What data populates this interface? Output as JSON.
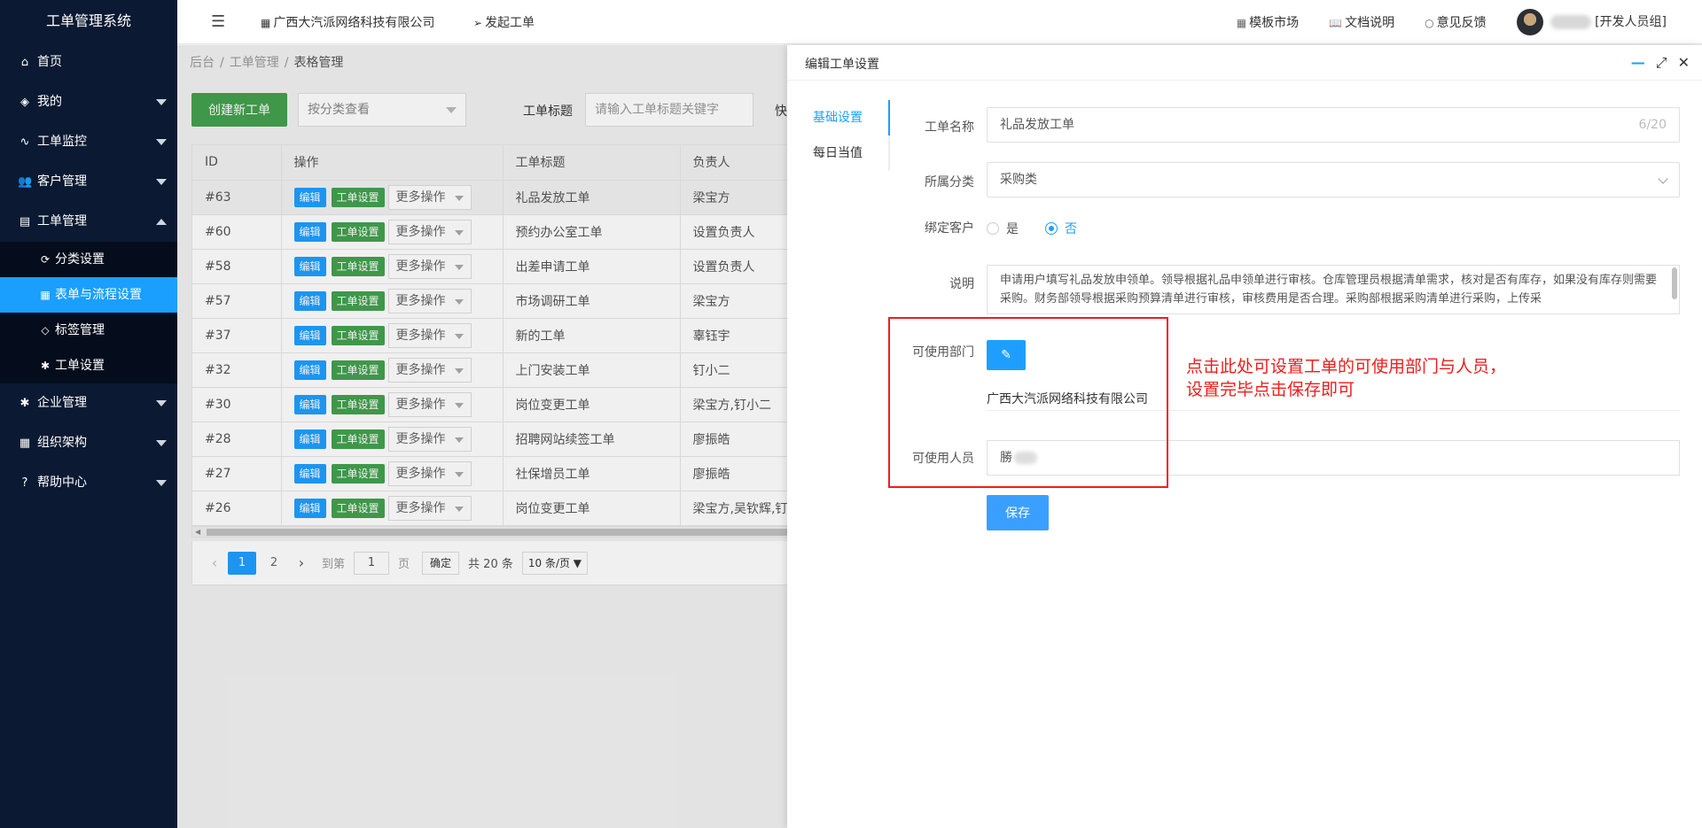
{
  "app": {
    "title": "工单管理系统"
  },
  "sidebar": {
    "items": [
      {
        "label": "首页",
        "icon": "home-icon",
        "glyph": "⌂"
      },
      {
        "label": "我的",
        "icon": "layers-icon",
        "glyph": "◈"
      },
      {
        "label": "工单监控",
        "icon": "pulse-icon",
        "glyph": "∿"
      },
      {
        "label": "客户管理",
        "icon": "users-icon",
        "glyph": "👥"
      },
      {
        "label": "工单管理",
        "icon": "document-icon",
        "glyph": "▤"
      }
    ],
    "sub_items": [
      {
        "label": "分类设置",
        "icon": "refresh-icon",
        "glyph": "⟳"
      },
      {
        "label": "表单与流程设置",
        "icon": "grid-icon",
        "glyph": "▦"
      },
      {
        "label": "标签管理",
        "icon": "tag-icon",
        "glyph": "◇"
      },
      {
        "label": "工单设置",
        "icon": "gear-icon",
        "glyph": "✱"
      }
    ],
    "more_items": [
      {
        "label": "企业管理",
        "icon": "gear-icon",
        "glyph": "✱"
      },
      {
        "label": "组织架构",
        "icon": "calendar-icon",
        "glyph": "▦"
      },
      {
        "label": "帮助中心",
        "icon": "question-icon",
        "glyph": "?"
      }
    ]
  },
  "topbar": {
    "company": "广西大汽派网络科技有限公司",
    "start_ticket": "发起工单",
    "links": {
      "templates": "模板市场",
      "docs": "文档说明",
      "feedback": "意见反馈"
    },
    "user_role": "[开发人员组]"
  },
  "breadcrumb": {
    "home": "后台",
    "level1": "工单管理",
    "current": "表格管理"
  },
  "toolbar": {
    "create_label": "创建新工单",
    "category_placeholder": "按分类查看",
    "title_label": "工单标题",
    "title_placeholder": "请输入工单标题关键字",
    "quick_label": "快"
  },
  "table": {
    "headers": {
      "id": "ID",
      "ops": "操作",
      "title": "工单标题",
      "owner": "负责人"
    },
    "btn_edit": "编辑",
    "btn_set": "工单设置",
    "btn_more": "更多操作",
    "rows": [
      {
        "id": "#63",
        "title": "礼品发放工单",
        "owner": "梁宝方"
      },
      {
        "id": "#60",
        "title": "预约办公室工单",
        "owner": "设置负责人"
      },
      {
        "id": "#58",
        "title": "出差申请工单",
        "owner": "设置负责人"
      },
      {
        "id": "#57",
        "title": "市场调研工单",
        "owner": "梁宝方"
      },
      {
        "id": "#37",
        "title": "新的工单",
        "owner": "辜钰宇"
      },
      {
        "id": "#32",
        "title": "上门安装工单",
        "owner": "钉小二"
      },
      {
        "id": "#30",
        "title": "岗位变更工单",
        "owner": "梁宝方,钉小二"
      },
      {
        "id": "#28",
        "title": "招聘网站续签工单",
        "owner": "廖振皓"
      },
      {
        "id": "#27",
        "title": "社保增员工单",
        "owner": "廖振皓"
      },
      {
        "id": "#26",
        "title": "岗位变更工单",
        "owner": "梁宝方,吴钦辉,钉"
      }
    ]
  },
  "pager": {
    "page1": "1",
    "page2": "2",
    "goto_label": "到第",
    "goto_value": "1",
    "page_unit": "页",
    "confirm": "确定",
    "total": "共 20 条",
    "page_size": "10 条/页 ▼"
  },
  "drawer": {
    "title": "编辑工单设置",
    "tabs": [
      "基础设置",
      "每日当值"
    ],
    "name_label": "工单名称",
    "name_value": "礼品发放工单",
    "name_count": "6/20",
    "category_label": "所属分类",
    "category_value": "采购类",
    "bind_label": "绑定客户",
    "bind_yes": "是",
    "bind_no": "否",
    "desc_label": "说明",
    "desc_value": "申请用户填写礼品发放申领单。领导根据礼品申领单进行审核。仓库管理员根据清单需求，核对是否有库存，如果没有库存则需要采购。财务部领导根据采购预算清单进行审核，审核费用是否合理。采购部根据采购清单进行采购，上传采",
    "dept_label": "可使用部门",
    "dept_value": "广西大汽派网络科技有限公司",
    "people_label": "可使用人员",
    "people_value": "勝",
    "save_label": "保存",
    "annotation_line1": "点击此处可设置工单的可使用部门与人员，",
    "annotation_line2": "设置完毕点击保存即可"
  },
  "colors": {
    "sidebar_bg": "#0b1a32",
    "accent": "#1e9fff",
    "success": "#43a14f",
    "annotation": "#f01c1c"
  }
}
